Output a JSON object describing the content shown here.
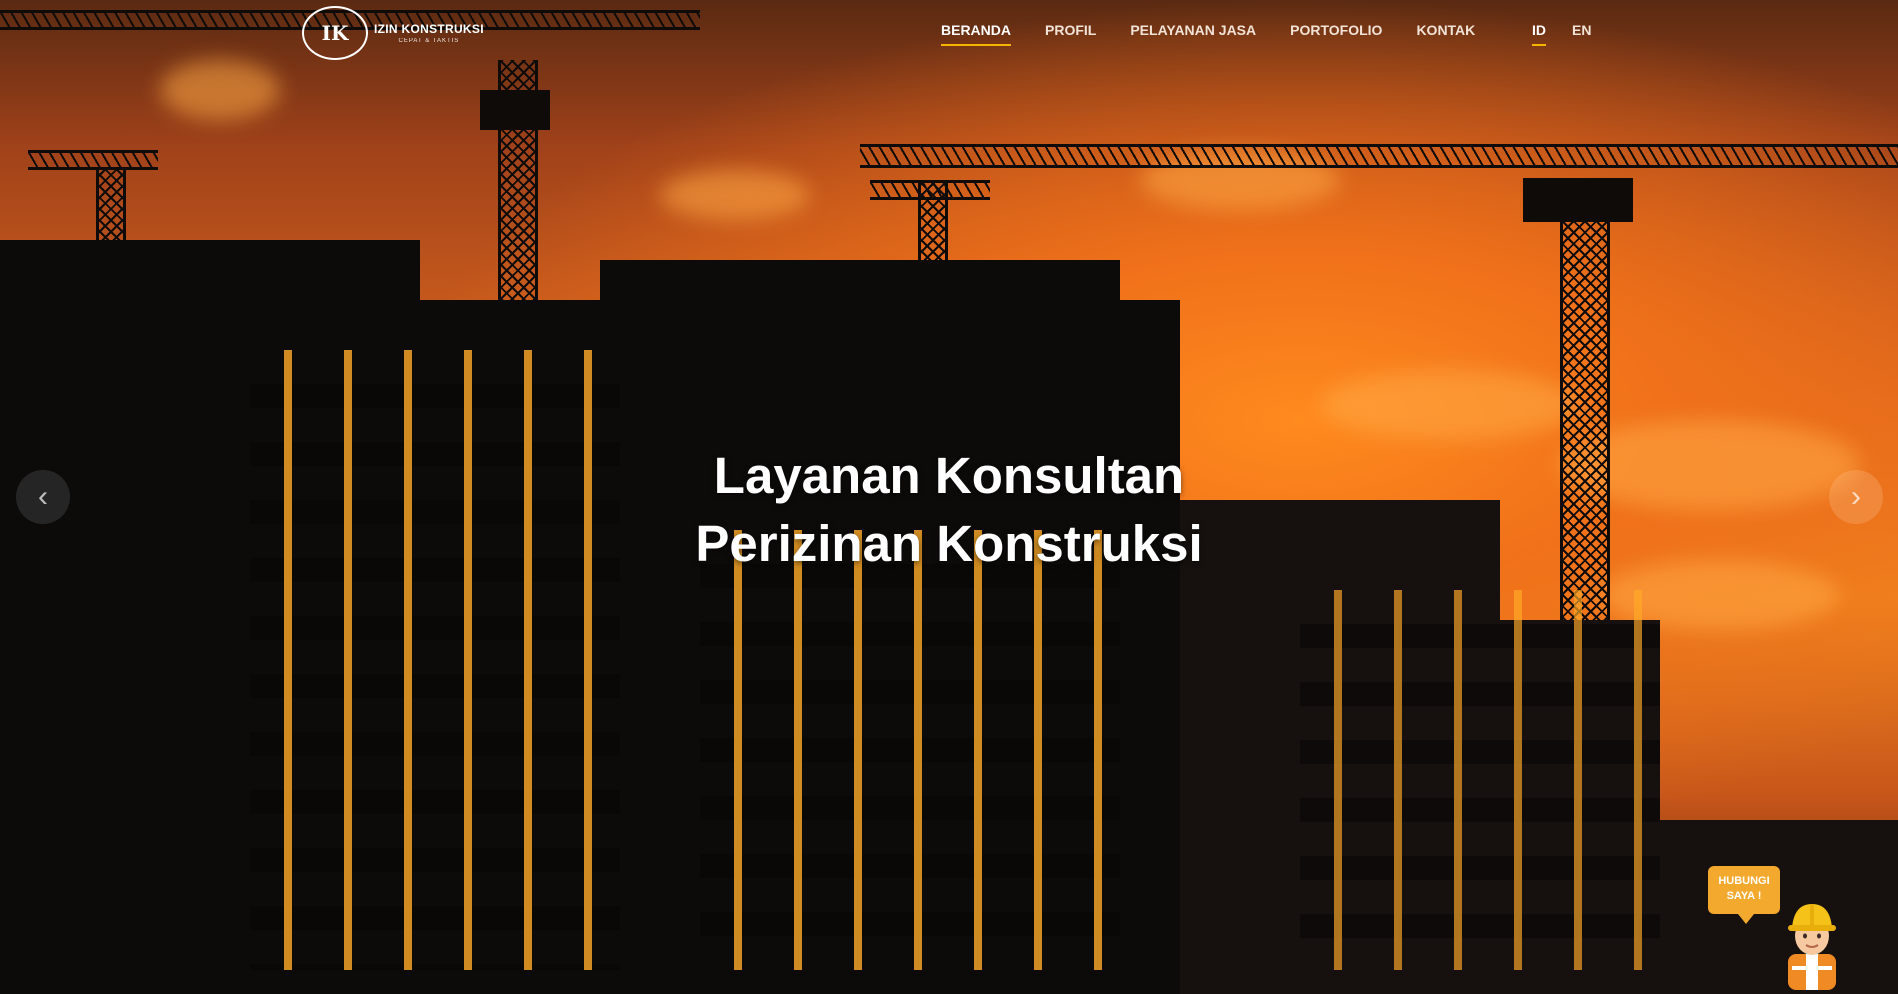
{
  "header": {
    "logo": {
      "mark": "IK",
      "title": "IZIN KONSTRUKSI",
      "tagline": "CEPAT & TAKTIS"
    },
    "nav": [
      {
        "label": "BERANDA",
        "active": true
      },
      {
        "label": "PROFIL",
        "active": false
      },
      {
        "label": "PELAYANAN JASA",
        "active": false
      },
      {
        "label": "PORTOFOLIO",
        "active": false
      },
      {
        "label": "KONTAK",
        "active": false
      }
    ],
    "languages": [
      {
        "label": "ID",
        "active": true
      },
      {
        "label": "EN",
        "active": false
      }
    ],
    "accent_color": "#f5b400"
  },
  "hero": {
    "headline_line1": "Layanan Konsultan",
    "headline_line2": "Perizinan Konstruksi",
    "prev_arrow": "‹",
    "next_arrow": "›"
  },
  "contact_widget": {
    "line1": "HUBUNGI",
    "line2": "SAYA !",
    "bubble_color": "#f3a92d",
    "icon": "construction-worker-icon"
  }
}
